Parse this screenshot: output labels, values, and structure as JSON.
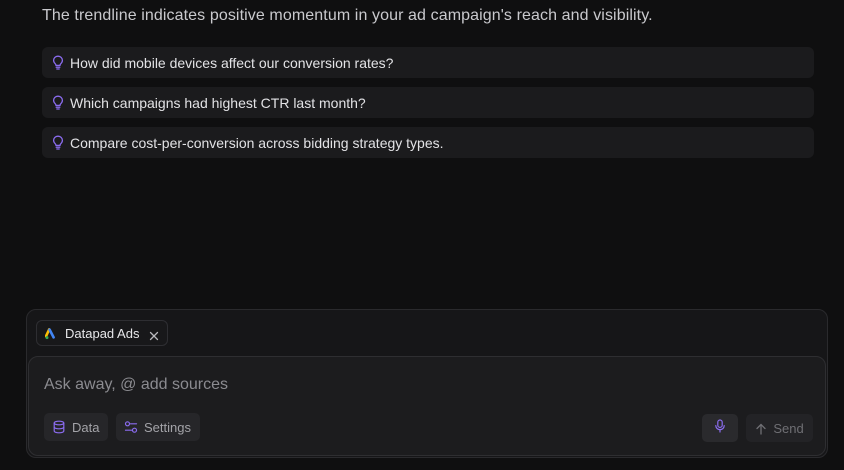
{
  "summary_text": "The trendline indicates positive momentum in your ad campaign's reach and visibility.",
  "suggestions": [
    {
      "icon": "lightbulb-icon",
      "label": "How did mobile devices affect our conversion rates?"
    },
    {
      "icon": "lightbulb-icon",
      "label": "Which campaigns had highest CTR last month?"
    },
    {
      "icon": "lightbulb-icon",
      "label": "Compare cost-per-conversion across bidding strategy types."
    }
  ],
  "composer": {
    "source_chip": {
      "icon": "google-ads-logo",
      "label": "Datapad Ads",
      "close_icon": "close-icon"
    },
    "input": {
      "value": "",
      "placeholder": "Ask away, @ add sources"
    },
    "data_button": {
      "icon": "database-icon",
      "label": "Data"
    },
    "settings_button": {
      "icon": "sliders-icon",
      "label": "Settings"
    },
    "mic_button": {
      "icon": "microphone-icon"
    },
    "send_button": {
      "icon": "arrow-up-icon",
      "label": "Send"
    }
  },
  "colors": {
    "accent": "#8b6cf0",
    "background": "#0f0f10",
    "card": "#1b1b1d"
  }
}
